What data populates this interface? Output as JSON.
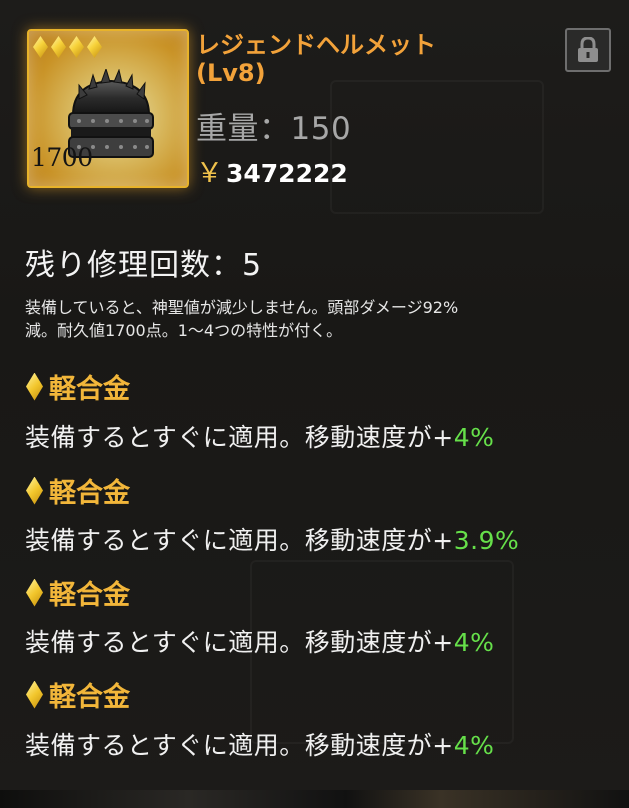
{
  "item": {
    "name_line1": "レジェンドヘルメット",
    "name_line2": "(Lv8)",
    "stars": 4,
    "durability": "1700",
    "weight_label": "重量：150",
    "price_symbol": "￥",
    "price": "3472222"
  },
  "repair_label": "残り修理回数：5",
  "description_line1": "装備していると、神聖値が減少しません。頭部ダメージ92%",
  "description_line2": "減。耐久値1700点。1～4つの特性が付く。",
  "traits": [
    {
      "title": "軽合金",
      "desc": "装備するとすぐに適用。移動速度が",
      "plus": "+",
      "value": "4%"
    },
    {
      "title": "軽合金",
      "desc": "装備するとすぐに適用。移動速度が",
      "plus": "+",
      "value": "3.9%"
    },
    {
      "title": "軽合金",
      "desc": "装備するとすぐに適用。移動速度が",
      "plus": "+",
      "value": "4%"
    },
    {
      "title": "軽合金",
      "desc": "装備するとすぐに適用。移動速度が",
      "plus": "+",
      "value": "4%"
    }
  ],
  "icons": {
    "lock": "lock-icon",
    "helmet": "helmet-icon",
    "star": "diamond-star-icon"
  },
  "colors": {
    "name": "#f2a23a",
    "trait_title": "#f2b63a",
    "trait_value": "#66e04a",
    "card_border": "#e8b32a"
  }
}
